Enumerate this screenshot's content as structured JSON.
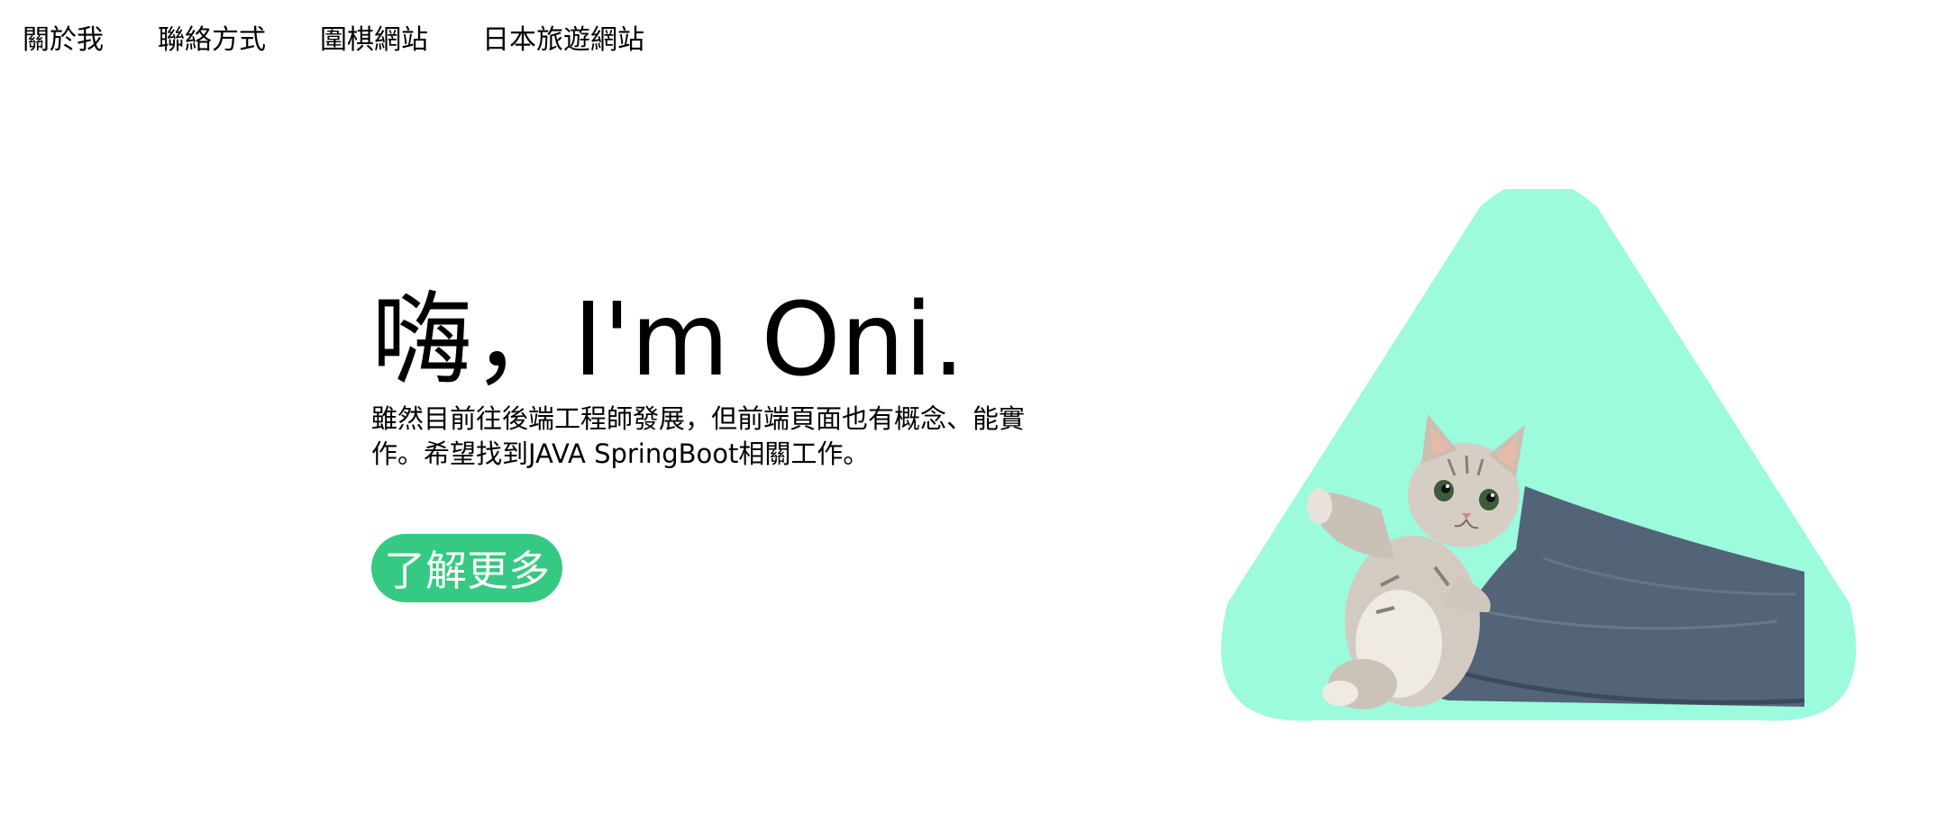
{
  "nav": {
    "items": [
      {
        "label": "關於我"
      },
      {
        "label": "聯絡方式"
      },
      {
        "label": "圍棋網站"
      },
      {
        "label": "日本旅遊網站"
      }
    ]
  },
  "hero": {
    "title": "嗨，I'm Oni.",
    "description": "雖然目前往後端工程師發展，但前端頁面也有概念、能實作。希望找到JAVA SpringBoot相關工作。",
    "cta_label": "了解更多"
  },
  "illustration": {
    "subject": "kitten-on-pillow",
    "triangle_color": "#9bfbdc",
    "pillow_color": "#536478"
  },
  "colors": {
    "accent": "#35c983",
    "text": "#000000",
    "background": "#ffffff"
  }
}
